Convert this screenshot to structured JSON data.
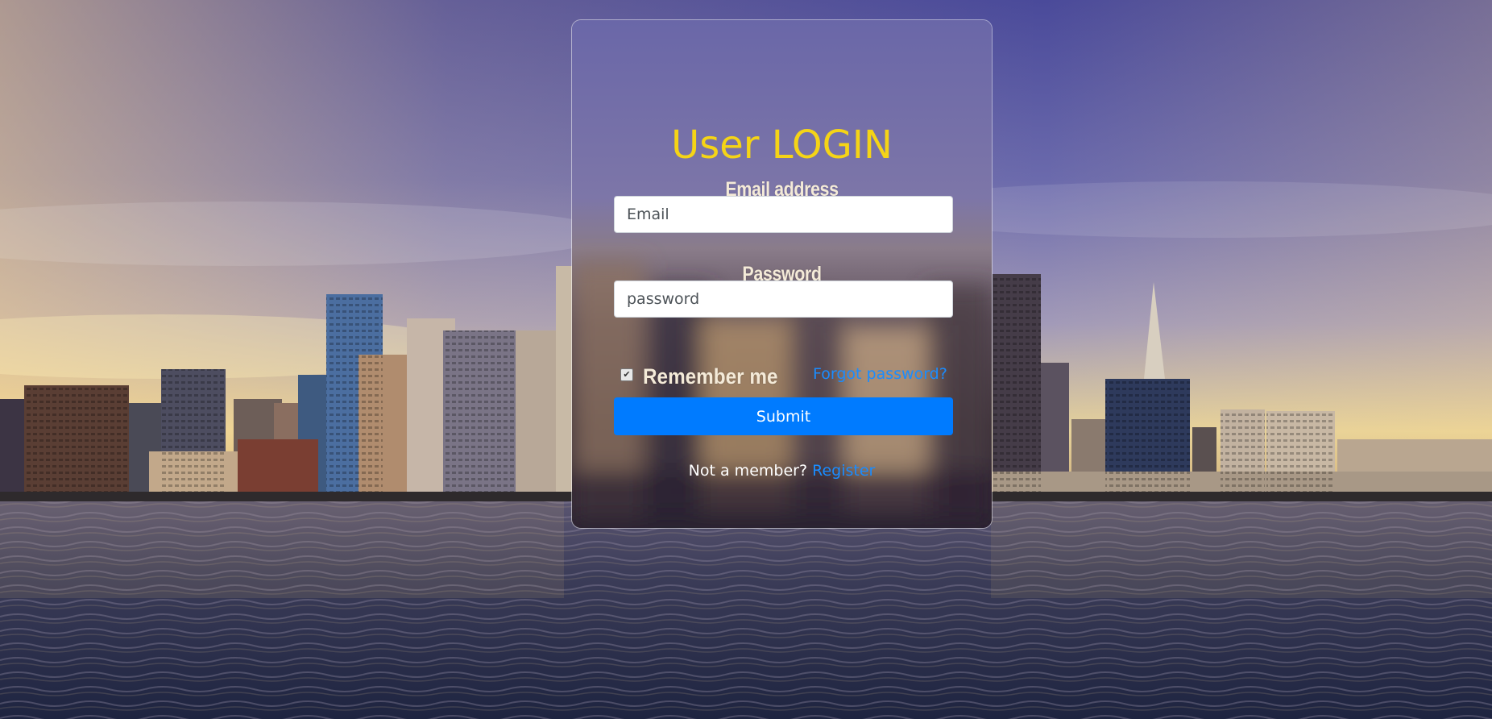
{
  "login": {
    "title": "User LOGIN",
    "email_label": "Email address",
    "email_placeholder": "Email",
    "password_label": "Password",
    "password_placeholder": "password",
    "remember_label": "Remember me",
    "remember_checked": true,
    "forgot_link": "Forgot password?",
    "submit_label": "Submit",
    "register_prompt": "Not a member?",
    "register_link": "Register"
  },
  "colors": {
    "title": "#f5d416",
    "label": "#f4ead8",
    "link": "#1a8cff",
    "submit_bg": "#007bff",
    "submit_text": "#ffffff"
  },
  "background": {
    "scene": "city skyline at dusk over water"
  }
}
